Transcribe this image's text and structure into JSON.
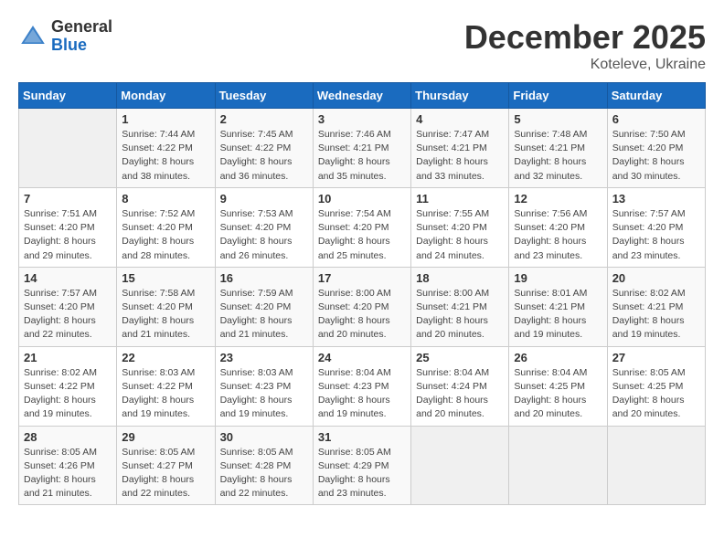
{
  "header": {
    "logo_general": "General",
    "logo_blue": "Blue",
    "month_title": "December 2025",
    "subtitle": "Koteleve, Ukraine"
  },
  "days_of_week": [
    "Sunday",
    "Monday",
    "Tuesday",
    "Wednesday",
    "Thursday",
    "Friday",
    "Saturday"
  ],
  "weeks": [
    [
      {
        "day": "",
        "info": ""
      },
      {
        "day": "1",
        "info": "Sunrise: 7:44 AM\nSunset: 4:22 PM\nDaylight: 8 hours\nand 38 minutes."
      },
      {
        "day": "2",
        "info": "Sunrise: 7:45 AM\nSunset: 4:22 PM\nDaylight: 8 hours\nand 36 minutes."
      },
      {
        "day": "3",
        "info": "Sunrise: 7:46 AM\nSunset: 4:21 PM\nDaylight: 8 hours\nand 35 minutes."
      },
      {
        "day": "4",
        "info": "Sunrise: 7:47 AM\nSunset: 4:21 PM\nDaylight: 8 hours\nand 33 minutes."
      },
      {
        "day": "5",
        "info": "Sunrise: 7:48 AM\nSunset: 4:21 PM\nDaylight: 8 hours\nand 32 minutes."
      },
      {
        "day": "6",
        "info": "Sunrise: 7:50 AM\nSunset: 4:20 PM\nDaylight: 8 hours\nand 30 minutes."
      }
    ],
    [
      {
        "day": "7",
        "info": "Sunrise: 7:51 AM\nSunset: 4:20 PM\nDaylight: 8 hours\nand 29 minutes."
      },
      {
        "day": "8",
        "info": "Sunrise: 7:52 AM\nSunset: 4:20 PM\nDaylight: 8 hours\nand 28 minutes."
      },
      {
        "day": "9",
        "info": "Sunrise: 7:53 AM\nSunset: 4:20 PM\nDaylight: 8 hours\nand 26 minutes."
      },
      {
        "day": "10",
        "info": "Sunrise: 7:54 AM\nSunset: 4:20 PM\nDaylight: 8 hours\nand 25 minutes."
      },
      {
        "day": "11",
        "info": "Sunrise: 7:55 AM\nSunset: 4:20 PM\nDaylight: 8 hours\nand 24 minutes."
      },
      {
        "day": "12",
        "info": "Sunrise: 7:56 AM\nSunset: 4:20 PM\nDaylight: 8 hours\nand 23 minutes."
      },
      {
        "day": "13",
        "info": "Sunrise: 7:57 AM\nSunset: 4:20 PM\nDaylight: 8 hours\nand 23 minutes."
      }
    ],
    [
      {
        "day": "14",
        "info": "Sunrise: 7:57 AM\nSunset: 4:20 PM\nDaylight: 8 hours\nand 22 minutes."
      },
      {
        "day": "15",
        "info": "Sunrise: 7:58 AM\nSunset: 4:20 PM\nDaylight: 8 hours\nand 21 minutes."
      },
      {
        "day": "16",
        "info": "Sunrise: 7:59 AM\nSunset: 4:20 PM\nDaylight: 8 hours\nand 21 minutes."
      },
      {
        "day": "17",
        "info": "Sunrise: 8:00 AM\nSunset: 4:20 PM\nDaylight: 8 hours\nand 20 minutes."
      },
      {
        "day": "18",
        "info": "Sunrise: 8:00 AM\nSunset: 4:21 PM\nDaylight: 8 hours\nand 20 minutes."
      },
      {
        "day": "19",
        "info": "Sunrise: 8:01 AM\nSunset: 4:21 PM\nDaylight: 8 hours\nand 19 minutes."
      },
      {
        "day": "20",
        "info": "Sunrise: 8:02 AM\nSunset: 4:21 PM\nDaylight: 8 hours\nand 19 minutes."
      }
    ],
    [
      {
        "day": "21",
        "info": "Sunrise: 8:02 AM\nSunset: 4:22 PM\nDaylight: 8 hours\nand 19 minutes."
      },
      {
        "day": "22",
        "info": "Sunrise: 8:03 AM\nSunset: 4:22 PM\nDaylight: 8 hours\nand 19 minutes."
      },
      {
        "day": "23",
        "info": "Sunrise: 8:03 AM\nSunset: 4:23 PM\nDaylight: 8 hours\nand 19 minutes."
      },
      {
        "day": "24",
        "info": "Sunrise: 8:04 AM\nSunset: 4:23 PM\nDaylight: 8 hours\nand 19 minutes."
      },
      {
        "day": "25",
        "info": "Sunrise: 8:04 AM\nSunset: 4:24 PM\nDaylight: 8 hours\nand 20 minutes."
      },
      {
        "day": "26",
        "info": "Sunrise: 8:04 AM\nSunset: 4:25 PM\nDaylight: 8 hours\nand 20 minutes."
      },
      {
        "day": "27",
        "info": "Sunrise: 8:05 AM\nSunset: 4:25 PM\nDaylight: 8 hours\nand 20 minutes."
      }
    ],
    [
      {
        "day": "28",
        "info": "Sunrise: 8:05 AM\nSunset: 4:26 PM\nDaylight: 8 hours\nand 21 minutes."
      },
      {
        "day": "29",
        "info": "Sunrise: 8:05 AM\nSunset: 4:27 PM\nDaylight: 8 hours\nand 22 minutes."
      },
      {
        "day": "30",
        "info": "Sunrise: 8:05 AM\nSunset: 4:28 PM\nDaylight: 8 hours\nand 22 minutes."
      },
      {
        "day": "31",
        "info": "Sunrise: 8:05 AM\nSunset: 4:29 PM\nDaylight: 8 hours\nand 23 minutes."
      },
      {
        "day": "",
        "info": ""
      },
      {
        "day": "",
        "info": ""
      },
      {
        "day": "",
        "info": ""
      }
    ]
  ]
}
